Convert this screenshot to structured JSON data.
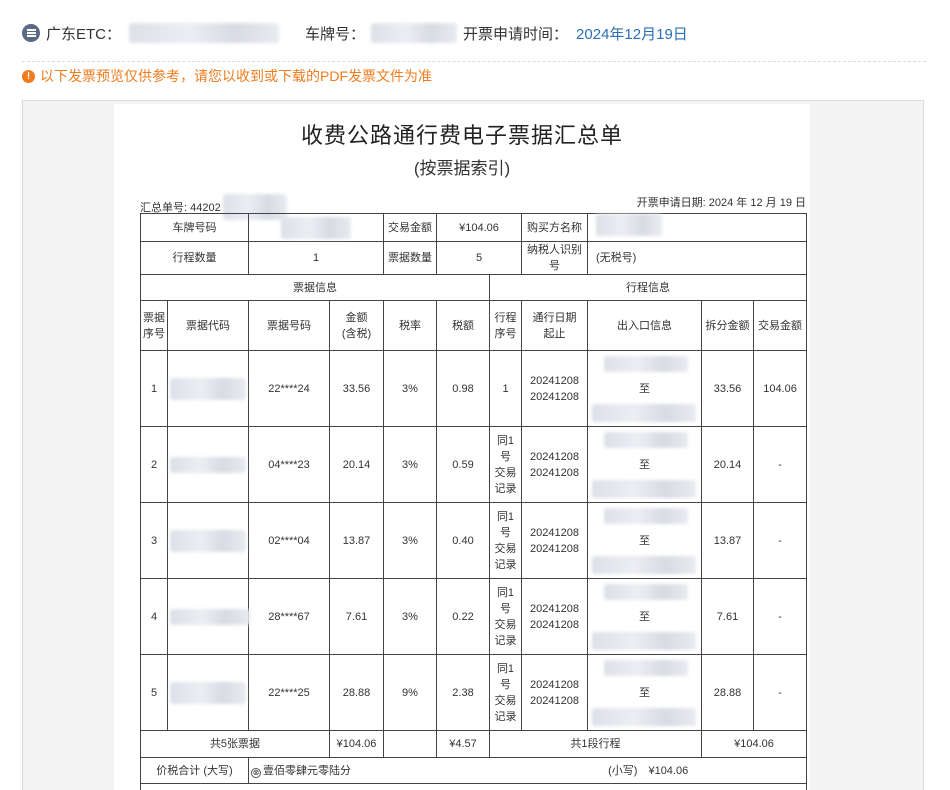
{
  "header": {
    "etc_label": "广东ETC：",
    "plate_label": "车牌号：",
    "apply_time_label": "开票申请时间：",
    "apply_time_value": "2024年12月19日"
  },
  "notice": "以下发票预览仅供参考，请您以收到或下载的PDF发票文件为准",
  "doc": {
    "title": "收费公路通行费电子票据汇总单",
    "subtitle": "(按票据索引)",
    "summary_no_label": "汇总单号: 44202",
    "apply_date": "开票申请日期: 2024 年 12 月 19 日",
    "r1": {
      "plate_label": "车牌号码",
      "amount_label": "交易金额",
      "amount_value": "¥104.06",
      "buyer_label": "购买方名称"
    },
    "r2": {
      "trip_count_label": "行程数量",
      "trip_count_value": "1",
      "ticket_count_label": "票据数量",
      "ticket_count_value": "5",
      "taxpayer_label": "纳税人识别号",
      "taxpayer_value": "(无税号)"
    },
    "sections": {
      "ticket_info": "票据信息",
      "trip_info": "行程信息"
    },
    "cols": {
      "seq_a": "票据",
      "seq_b": "序号",
      "code": "票据代码",
      "number": "票据号码",
      "amt_a": "金额",
      "amt_b": "(含税)",
      "rate": "税率",
      "tax": "税额",
      "trip_a": "行程",
      "trip_b": "序号",
      "date_a": "通行日期",
      "date_b": "起止",
      "io": "出入口信息",
      "split": "拆分金额",
      "trade": "交易金额"
    },
    "rows": [
      {
        "seq": "1",
        "number": "22****24",
        "amount": "33.56",
        "rate": "3%",
        "tax": "0.98",
        "trip": [
          "1"
        ],
        "date1": "20241208",
        "date2": "20241208",
        "zhi": "至",
        "split": "33.56",
        "trade": "104.06"
      },
      {
        "seq": "2",
        "number": "04****23",
        "amount": "20.14",
        "rate": "3%",
        "tax": "0.59",
        "trip": [
          "同1号",
          "交易",
          "记录"
        ],
        "date1": "20241208",
        "date2": "20241208",
        "zhi": "至",
        "split": "20.14",
        "trade": "-"
      },
      {
        "seq": "3",
        "number": "02****04",
        "amount": "13.87",
        "rate": "3%",
        "tax": "0.40",
        "trip": [
          "同1号",
          "交易",
          "记录"
        ],
        "date1": "20241208",
        "date2": "20241208",
        "zhi": "至",
        "split": "13.87",
        "trade": "-"
      },
      {
        "seq": "4",
        "number": "28****67",
        "amount": "7.61",
        "rate": "3%",
        "tax": "0.22",
        "trip": [
          "同1号",
          "交易",
          "记录"
        ],
        "date1": "20241208",
        "date2": "20241208",
        "zhi": "至",
        "split": "7.61",
        "trade": "-"
      },
      {
        "seq": "5",
        "number": "22****25",
        "amount": "28.88",
        "rate": "9%",
        "tax": "2.38",
        "trip": [
          "同1号",
          "交易",
          "记录"
        ],
        "date1": "20241208",
        "date2": "20241208",
        "zhi": "至",
        "split": "28.88",
        "trade": "-"
      }
    ],
    "sum": {
      "tickets": "共5张票据",
      "amount": "¥104.06",
      "tax": "¥4.57",
      "trips": "共1段行程",
      "split": "¥104.06"
    },
    "total": {
      "label": "价税合计 (大写)",
      "circle": "⊗",
      "upper": "壹佰零肆元零陆分",
      "lower_label": "(小写)",
      "lower_value": "¥104.06"
    }
  }
}
